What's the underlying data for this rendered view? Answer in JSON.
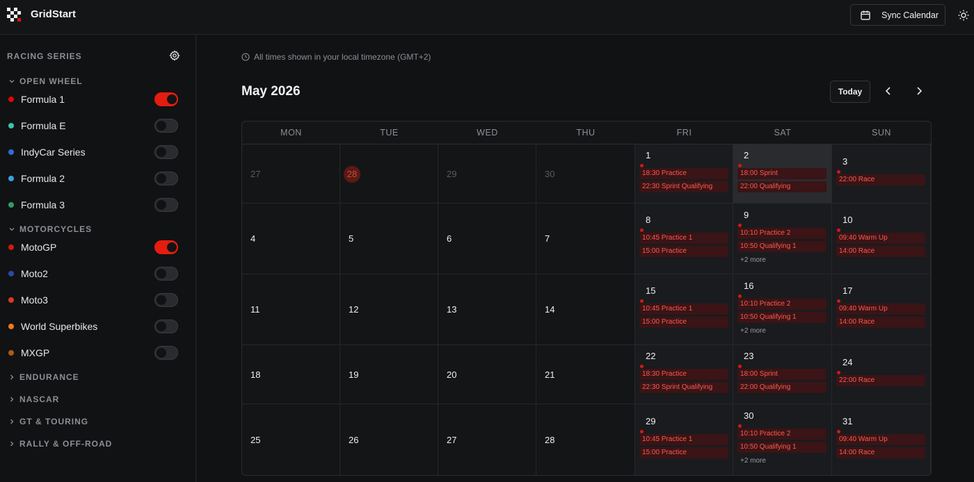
{
  "app": {
    "brand": "GridStart"
  },
  "header": {
    "sync_label": "Sync Calendar"
  },
  "sidebar": {
    "title": "RACING SERIES",
    "groups": [
      {
        "label": "OPEN WHEEL",
        "expanded": true,
        "items": [
          {
            "label": "Formula 1",
            "color": "#e10600",
            "enabled": true
          },
          {
            "label": "Formula E",
            "color": "#3ec1b0",
            "enabled": false
          },
          {
            "label": "IndyCar Series",
            "color": "#2f6bd8",
            "enabled": false
          },
          {
            "label": "Formula 2",
            "color": "#3a9fe0",
            "enabled": false
          },
          {
            "label": "Formula 3",
            "color": "#2f9d6a",
            "enabled": false
          }
        ]
      },
      {
        "label": "MOTORCYCLES",
        "expanded": true,
        "items": [
          {
            "label": "MotoGP",
            "color": "#d11a12",
            "enabled": true
          },
          {
            "label": "Moto2",
            "color": "#2b4aa8",
            "enabled": false
          },
          {
            "label": "Moto3",
            "color": "#e0371f",
            "enabled": false
          },
          {
            "label": "World Superbikes",
            "color": "#f07a18",
            "enabled": false
          },
          {
            "label": "MXGP",
            "color": "#b05a10",
            "enabled": false
          }
        ]
      },
      {
        "label": "ENDURANCE",
        "expanded": false
      },
      {
        "label": "NASCAR",
        "expanded": false
      },
      {
        "label": "GT & TOURING",
        "expanded": false
      },
      {
        "label": "RALLY & OFF-ROAD",
        "expanded": false
      }
    ]
  },
  "main": {
    "timezone_note": "All times shown in your local timezone (GMT+2)",
    "month_title": "May 2026",
    "today_label": "Today",
    "weekdays": [
      "MON",
      "TUE",
      "WED",
      "THU",
      "FRI",
      "SAT",
      "SUN"
    ],
    "weeks": [
      [
        {
          "day": "27",
          "other_month": true
        },
        {
          "day": "28",
          "other_month": true,
          "today": true
        },
        {
          "day": "29",
          "other_month": true
        },
        {
          "day": "30",
          "other_month": true
        },
        {
          "day": "1",
          "events": [
            "18:30 Practice",
            "22:30 Sprint Qualifying"
          ]
        },
        {
          "day": "2",
          "highlight": true,
          "events": [
            "18:00 Sprint",
            "22:00 Qualifying"
          ]
        },
        {
          "day": "3",
          "events": [
            "22:00 Race"
          ]
        }
      ],
      [
        {
          "day": "4"
        },
        {
          "day": "5"
        },
        {
          "day": "6"
        },
        {
          "day": "7"
        },
        {
          "day": "8",
          "events": [
            "10:45 Practice 1",
            "15:00 Practice"
          ]
        },
        {
          "day": "9",
          "events": [
            "10:10 Practice 2",
            "10:50 Qualifying 1"
          ],
          "more": "+2 more"
        },
        {
          "day": "10",
          "events": [
            "09:40 Warm Up",
            "14:00 Race"
          ]
        }
      ],
      [
        {
          "day": "11"
        },
        {
          "day": "12"
        },
        {
          "day": "13"
        },
        {
          "day": "14"
        },
        {
          "day": "15",
          "events": [
            "10:45 Practice 1",
            "15:00 Practice"
          ]
        },
        {
          "day": "16",
          "events": [
            "10:10 Practice 2",
            "10:50 Qualifying 1"
          ],
          "more": "+2 more"
        },
        {
          "day": "17",
          "events": [
            "09:40 Warm Up",
            "14:00 Race"
          ]
        }
      ],
      [
        {
          "day": "18"
        },
        {
          "day": "19"
        },
        {
          "day": "20"
        },
        {
          "day": "21"
        },
        {
          "day": "22",
          "events": [
            "18:30 Practice",
            "22:30 Sprint Qualifying"
          ]
        },
        {
          "day": "23",
          "events": [
            "18:00 Sprint",
            "22:00 Qualifying"
          ]
        },
        {
          "day": "24",
          "events": [
            "22:00 Race"
          ]
        }
      ],
      [
        {
          "day": "25"
        },
        {
          "day": "26"
        },
        {
          "day": "27"
        },
        {
          "day": "28"
        },
        {
          "day": "29",
          "events": [
            "10:45 Practice 1",
            "15:00 Practice"
          ]
        },
        {
          "day": "30",
          "events": [
            "10:10 Practice 2",
            "10:50 Qualifying 1"
          ],
          "more": "+2 more"
        },
        {
          "day": "31",
          "events": [
            "09:40 Warm Up",
            "14:00 Race"
          ]
        }
      ]
    ]
  },
  "colors": {
    "accent": "#e51c10",
    "event_bg": "#3a1416",
    "event_text": "#ff5a4d"
  }
}
